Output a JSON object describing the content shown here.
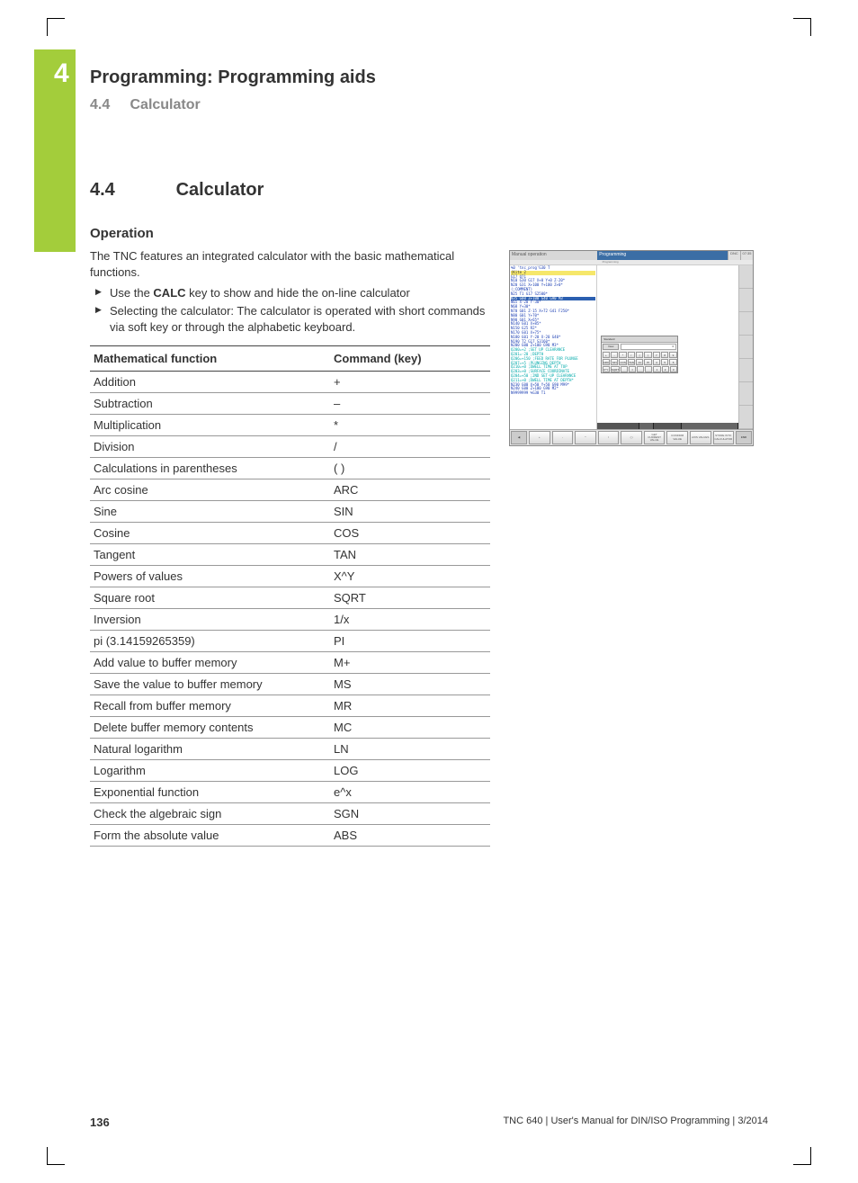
{
  "chapter": {
    "number": "4",
    "title": "Programming: Programming aids"
  },
  "breadcrumb": {
    "num": "4.4",
    "title": "Calculator"
  },
  "section": {
    "num": "4.4",
    "title": "Calculator"
  },
  "operation": {
    "heading": "Operation",
    "intro": "The TNC features an integrated calculator with the basic mathematical functions.",
    "bullet1_pre": "Use the ",
    "bullet1_key": "CALC",
    "bullet1_post": " key to show and hide the on-line calculator",
    "bullet2": "Selecting the calculator: The calculator is operated with short commands via soft key or through the alphabetic keyboard."
  },
  "table": {
    "h1": "Mathematical function",
    "h2": "Command (key)",
    "rows": [
      {
        "f": "Addition",
        "k": "+"
      },
      {
        "f": "Subtraction",
        "k": "–"
      },
      {
        "f": "Multiplication",
        "k": "*"
      },
      {
        "f": "Division",
        "k": "/"
      },
      {
        "f": "Calculations in parentheses",
        "k": "( )"
      },
      {
        "f": "Arc cosine",
        "k": "ARC"
      },
      {
        "f": "Sine",
        "k": "SIN"
      },
      {
        "f": "Cosine",
        "k": "COS"
      },
      {
        "f": "Tangent",
        "k": "TAN"
      },
      {
        "f": "Powers of values",
        "k": "X^Y"
      },
      {
        "f": "Square root",
        "k": "SQRT"
      },
      {
        "f": "Inversion",
        "k": "1/x"
      },
      {
        "f": "pi (3.14159265359)",
        "k": "PI"
      },
      {
        "f": "Add value to buffer memory",
        "k": "M+"
      },
      {
        "f": "Save the value to buffer memory",
        "k": "MS"
      },
      {
        "f": "Recall from buffer memory",
        "k": "MR"
      },
      {
        "f": "Delete buffer memory contents",
        "k": "MC"
      },
      {
        "f": "Natural logarithm",
        "k": "LN"
      },
      {
        "f": "Logarithm",
        "k": "LOG"
      },
      {
        "f": "Exponential function",
        "k": "e^x"
      },
      {
        "f": "Check the algebraic sign",
        "k": "SGN"
      },
      {
        "f": "Form the absolute value",
        "k": "ABS"
      }
    ]
  },
  "screenshot": {
    "mode_left": "Manual operation",
    "mode_right": "Programming",
    "sub": "Programming",
    "dnc": "DNC",
    "time": "07:35",
    "calc_title": "Standard",
    "calc_view": "View",
    "calc_value": "0",
    "calc_rows": [
      [
        "+",
        "-",
        "*",
        "/",
        "(",
        ")",
        "7",
        "8",
        "9"
      ],
      [
        "ARC",
        "SIN",
        "COS",
        "TAN",
        "1/x",
        "PI",
        "4",
        "5",
        "6"
      ],
      [
        "X^Y",
        "SQRT",
        "",
        "=",
        "",
        "",
        "1",
        "2",
        "3"
      ]
    ],
    "code": [
      "%0 'tnc_prog'G30 T",
      "(Kite 2",
      "G17 Q71",
      "N10 G30 G17 X+0 Y+0 Z-20*",
      "N20 G31 X+100 Y+100 Z+0*",
      "(;COMMENT)",
      "N25 T1 G17 S2500*",
      "N35 G00 Z+100 G40 G90 M3",
      "N65 X-20 Y-30*",
      "N68 Y+30*",
      "N70 G01 Z-15 X+72 G41 F250*",
      "N80 G01 Y+70*",
      "N90 G01 X+65*",
      "N140 G01 X+85*",
      "N150 G25 R2*",
      "N170 G01 X+75*",
      "N180 G01 Y-20 X-20 G40*",
      "N190 T2 G17 S3160*",
      "N200 G00 Z+100 G90 M3*",
      "  Q200=+2    ;SET UP CLEARANCE",
      "  Q201=-20   ;DEPTH",
      "  Q206=+150  ;FEED RATE FOR PLUNGE",
      "  Q207=+5    ;PLUNGING DEPTH",
      "  Q210=+0    ;DWELL TIME AT TOP",
      "  Q203=+0    ;SURFACE COORDINATE",
      "  Q204=+50   ;2ND SET-UP CLEARANCE",
      "  Q211=+0    ;DWELL TIME AT DEPTH*",
      "N230 G00 X+50 Y+50 G90 M99*",
      "N240 G00 Z+100 G90 M2*",
      "N9999999 %G30 T1"
    ],
    "softkeys": [
      "+",
      "-",
      "*",
      "/",
      "( )",
      "GET CURRENT VALUE",
      "CONFIRM VALUE",
      "AXIS VALUES",
      "STORE INTO CALCULATOR"
    ],
    "end": "END"
  },
  "footer": {
    "page": "136",
    "info": "TNC 640 | User's Manual for DIN/ISO Programming | 3/2014"
  }
}
